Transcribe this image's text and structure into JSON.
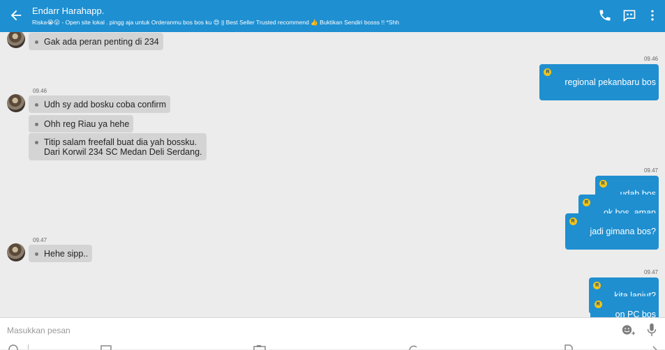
{
  "header": {
    "title": "Endarr Harahapp.",
    "subtitle": "Riska😭😮 - Open site lokal . pingg aja untuk Orderanmu bos bos ku 😍 || Best Seller Trusted recommend 👍 Buktikan Sendiri bosss !! *Shh",
    "icons": [
      "back-arrow-icon",
      "phone-icon",
      "chat-bubble-icon",
      "more-vert-icon"
    ]
  },
  "messages": [
    {
      "type": "in",
      "text": "Gak ada peran penting di 234"
    },
    {
      "type": "time-out",
      "text": "09.46"
    },
    {
      "type": "out",
      "text": "regional pekanbaru bos"
    },
    {
      "type": "time-in",
      "text": "09.46"
    },
    {
      "type": "in",
      "text": "Udh sy add bosku coba confirm"
    },
    {
      "type": "in",
      "text": "Ohh reg Riau ya hehe"
    },
    {
      "type": "in",
      "text": "Titip salam freefall buat dia yah bossku.\nDari Korwil 234 SC Medan Deli Serdang."
    },
    {
      "type": "time-out",
      "text": "09.47"
    },
    {
      "type": "out",
      "text": "udah bos"
    },
    {
      "type": "out",
      "text": "ok bos, aman"
    },
    {
      "type": "out",
      "text": "jadi gimana bos?"
    },
    {
      "type": "time-in",
      "text": "09.47"
    },
    {
      "type": "in",
      "text": "Hehe sipp.."
    },
    {
      "type": "time-out",
      "text": "09.47"
    },
    {
      "type": "out",
      "text": "kita lanjut?"
    },
    {
      "type": "out",
      "text": "on PC bos"
    }
  ],
  "badge_letter": "R",
  "input": {
    "placeholder": "Masukkan pesan",
    "value": ""
  },
  "colors": {
    "header": "#1e8fd1",
    "bubble_out": "#1f8fd0",
    "bubble_in": "#d4d4d4",
    "background": "#ececec"
  }
}
